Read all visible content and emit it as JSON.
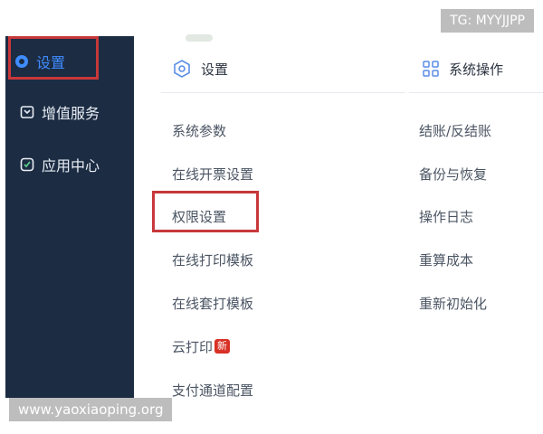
{
  "watermarks": {
    "tg": "TG: MYYJJPP",
    "url": "www.yaoxiaoping.org"
  },
  "sidebar": {
    "items": [
      {
        "label": "设置",
        "icon": "settings-icon",
        "active": true
      },
      {
        "label": "增值服务",
        "icon": "value-added-icon",
        "active": false
      },
      {
        "label": "应用中心",
        "icon": "app-center-icon",
        "active": false
      }
    ]
  },
  "menu": {
    "settings": {
      "title": "设置",
      "icon": "gear-icon",
      "items": [
        "系统参数",
        "在线开票设置",
        "权限设置",
        "在线打印模板",
        "在线套打模板",
        "云打印",
        "支付通道配置"
      ],
      "new_badge": "新"
    },
    "system_ops": {
      "title": "系统操作",
      "icon": "grid-icon",
      "items": [
        "结账/反结账",
        "备份与恢复",
        "操作日志",
        "重算成本",
        "重新初始化"
      ]
    }
  },
  "colors": {
    "sidebar_bg": "#1c2c43",
    "accent": "#3f8cff",
    "highlight": "#c8383a"
  }
}
